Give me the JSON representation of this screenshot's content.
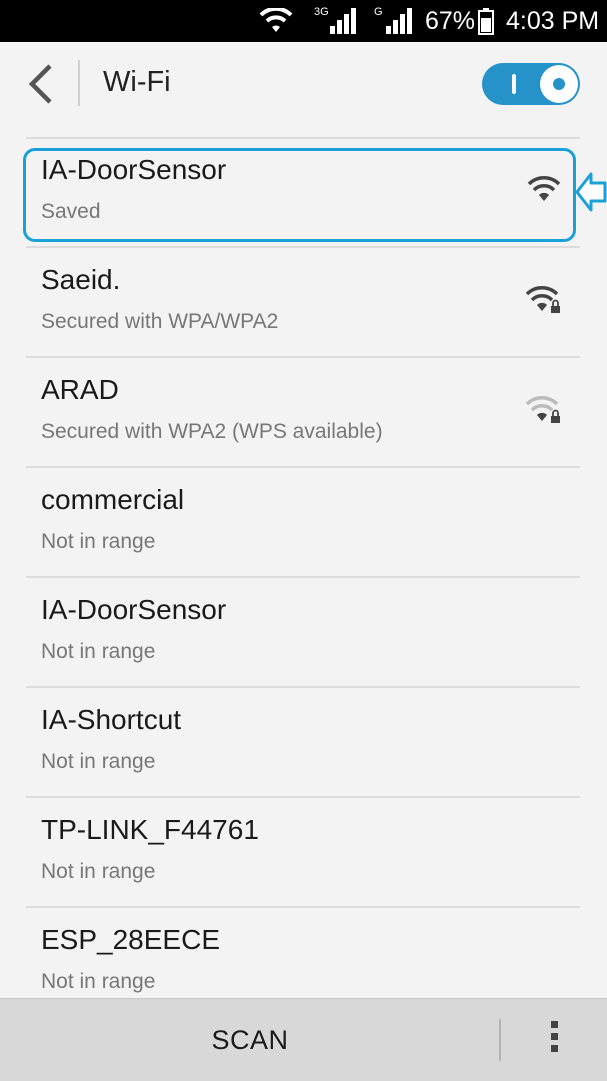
{
  "status_bar": {
    "net1_label": "3G",
    "net2_label": "G",
    "battery": "67%",
    "time": "4:03 PM"
  },
  "action_bar": {
    "title": "Wi-Fi",
    "wifi_enabled": true,
    "accent_color": "#2592c9"
  },
  "networks": [
    {
      "ssid": "IA-DoorSensor",
      "status": "Saved",
      "signal_icon": "wifi-strong-icon",
      "secured": false,
      "highlighted": true
    },
    {
      "ssid": "Saeid.",
      "status": "Secured with WPA/WPA2",
      "signal_icon": "wifi-lock-strong-icon",
      "secured": true
    },
    {
      "ssid": "ARAD",
      "status": "Secured with WPA2 (WPS available)",
      "signal_icon": "wifi-lock-weak-icon",
      "secured": true
    },
    {
      "ssid": "commercial",
      "status": "Not in range"
    },
    {
      "ssid": "IA-DoorSensor",
      "status": "Not in range"
    },
    {
      "ssid": "IA-Shortcut",
      "status": "Not in range"
    },
    {
      "ssid": "TP-LINK_F44761",
      "status": "Not in range"
    },
    {
      "ssid": "ESP_28EECE",
      "status": "Not in range"
    }
  ],
  "bottom_bar": {
    "scan_label": "SCAN"
  }
}
